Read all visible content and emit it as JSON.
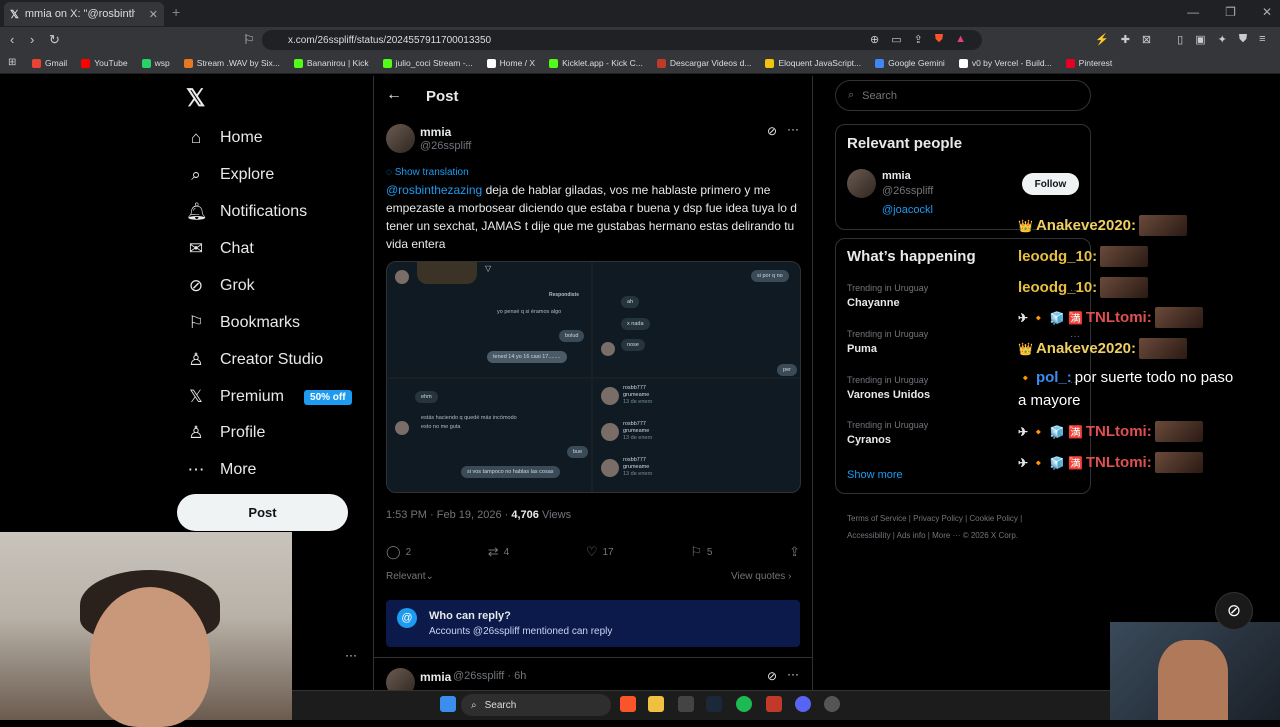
{
  "browser": {
    "tab_title": "mmia on X: \"@rosbinthezazing d",
    "url": "x.com/26sspliff/status/2024557911700013350",
    "bookmarks": [
      "Gmail",
      "YouTube",
      "wsp",
      "Stream .WAV by Six...",
      "Bananirou | Kick",
      "julio_coci Stream -...",
      "Home / X",
      "Kicklet.app - Kick C...",
      "Descargar Videos d...",
      "Eloquent JavaScript...",
      "Google Gemini",
      "v0 by Vercel - Build...",
      "Pinterest"
    ],
    "bookmark_colors": [
      "#ea4335",
      "#ff0000",
      "#25d366",
      "#e87722",
      "#53fc18",
      "#53fc18",
      "#ffffff",
      "#53fc18",
      "#c0392b",
      "#f1c40f",
      "#4285f4",
      "#ffffff",
      "#e60023"
    ]
  },
  "nav": {
    "logo": "𝕏",
    "items": [
      {
        "label": "Home",
        "icon": "⌂"
      },
      {
        "label": "Explore",
        "icon": "⌕"
      },
      {
        "label": "Notifications",
        "icon": "🔔︎"
      },
      {
        "label": "Chat",
        "icon": "✉"
      },
      {
        "label": "Grok",
        "icon": "⊘"
      },
      {
        "label": "Bookmarks",
        "icon": "⚐"
      },
      {
        "label": "Creator Studio",
        "icon": "♙"
      },
      {
        "label": "Premium",
        "icon": "𝕏"
      },
      {
        "label": "Profile",
        "icon": "♙"
      },
      {
        "label": "More",
        "icon": "⋯"
      }
    ],
    "premium_badge": "50% off",
    "post_button": "Post"
  },
  "post": {
    "header_title": "Post",
    "author_name": "mmia",
    "author_handle": "@26sspliff",
    "show_translation": "Show translation",
    "mention": "@rosbinthezazing",
    "text": " deja de hablar giladas, vos me hablaste primero y me empezaste a morbosear diciendo que estaba r buena y dsp fue idea tuya lo d tener un sexchat, JAMAS t dije que me gustabas hermano estas delirando tu vida entera",
    "time": "1:53 PM · Feb 19, 2026 · ",
    "views_count": "4,706",
    "views_label": " Views",
    "replies": "2",
    "reposts": "4",
    "likes": "17",
    "bookmarks": "5",
    "relevant_label": "Relevant",
    "view_quotes": "View quotes",
    "who_can_reply_title": "Who can reply?",
    "who_can_reply_sub": "Accounts @26sspliff mentioned can reply",
    "next_reply_name": "mmia",
    "next_reply_handle": "@26sspliff · 6h"
  },
  "media": {
    "p1": {
      "label": "Respondiste",
      "b1": "yo pensé q si éramos algo",
      "b2": "bolud",
      "b3": "tened 14 yo 16 casi 17........"
    },
    "p2": {
      "b1": "si por q no",
      "b2": "ah",
      "b3": "x nada",
      "b4": "nose",
      "b5": "per"
    },
    "p3": {
      "b1": "ehm",
      "b2": "estás haciendo q quedé más incómodo",
      "b3": "esto no me guta",
      "b4": "bue",
      "b5": "si vos tampoco no hablas las cosas"
    },
    "p4": {
      "dms": [
        {
          "name": "rosbb777",
          "sub": "grumeame",
          "date": "13 de enero"
        },
        {
          "name": "rosbb777",
          "sub": "grumeame",
          "date": "13 de enero"
        },
        {
          "name": "rosbb777",
          "sub": "grumeame",
          "date": "13 de enero"
        }
      ]
    }
  },
  "sidebar": {
    "search_placeholder": "Search",
    "relevant_title": "Relevant people",
    "rel_name": "mmia",
    "rel_handle": "@26sspliff",
    "rel_bio": "@joacockl",
    "follow": "Follow",
    "trending_title": "What’s happening",
    "trends": [
      {
        "context": "Trending in Uruguay",
        "name": "Chayanne"
      },
      {
        "context": "Trending in Uruguay",
        "name": "Puma"
      },
      {
        "context": "Trending in Uruguay",
        "name": "Varones Unidos"
      },
      {
        "context": "Trending in Uruguay",
        "name": "Cyranos"
      }
    ],
    "show_more": "Show more",
    "footer1": "Terms of Service  |  Privacy Policy  |  Cookie Policy  |",
    "footer2": "Accessibility  |  Ads info  |  More ···  © 2026 X Corp."
  },
  "chat": [
    {
      "user": "Anakeve2020:",
      "color": "#f0d060",
      "prefix": "👑",
      "msg": ""
    },
    {
      "user": "leoodg_10:",
      "color": "#e8c040",
      "prefix": "",
      "msg": ""
    },
    {
      "user": "leoodg_10:",
      "color": "#e8c040",
      "prefix": "",
      "msg": ""
    },
    {
      "user": "TNLtomi:",
      "color": "#e05050",
      "prefix": "✈ 🔸 🧊 🈵",
      "msg": ""
    },
    {
      "user": "Anakeve2020:",
      "color": "#f0d060",
      "prefix": "👑",
      "msg": ""
    },
    {
      "user": "pol_:",
      "color": "#3a8ef0",
      "prefix": "🔸",
      "msg": " por suerte todo no paso"
    },
    {
      "user": "",
      "color": "#ffffff",
      "prefix": "",
      "msg": "a mayore"
    },
    {
      "user": "TNLtomi:",
      "color": "#e05050",
      "prefix": "✈ 🔸 🧊 🈵",
      "msg": ""
    },
    {
      "user": "TNLtomi:",
      "color": "#e05050",
      "prefix": "✈ 🔸 🧊 🈵",
      "msg": ""
    }
  ],
  "taskbar": {
    "search": "Search"
  }
}
